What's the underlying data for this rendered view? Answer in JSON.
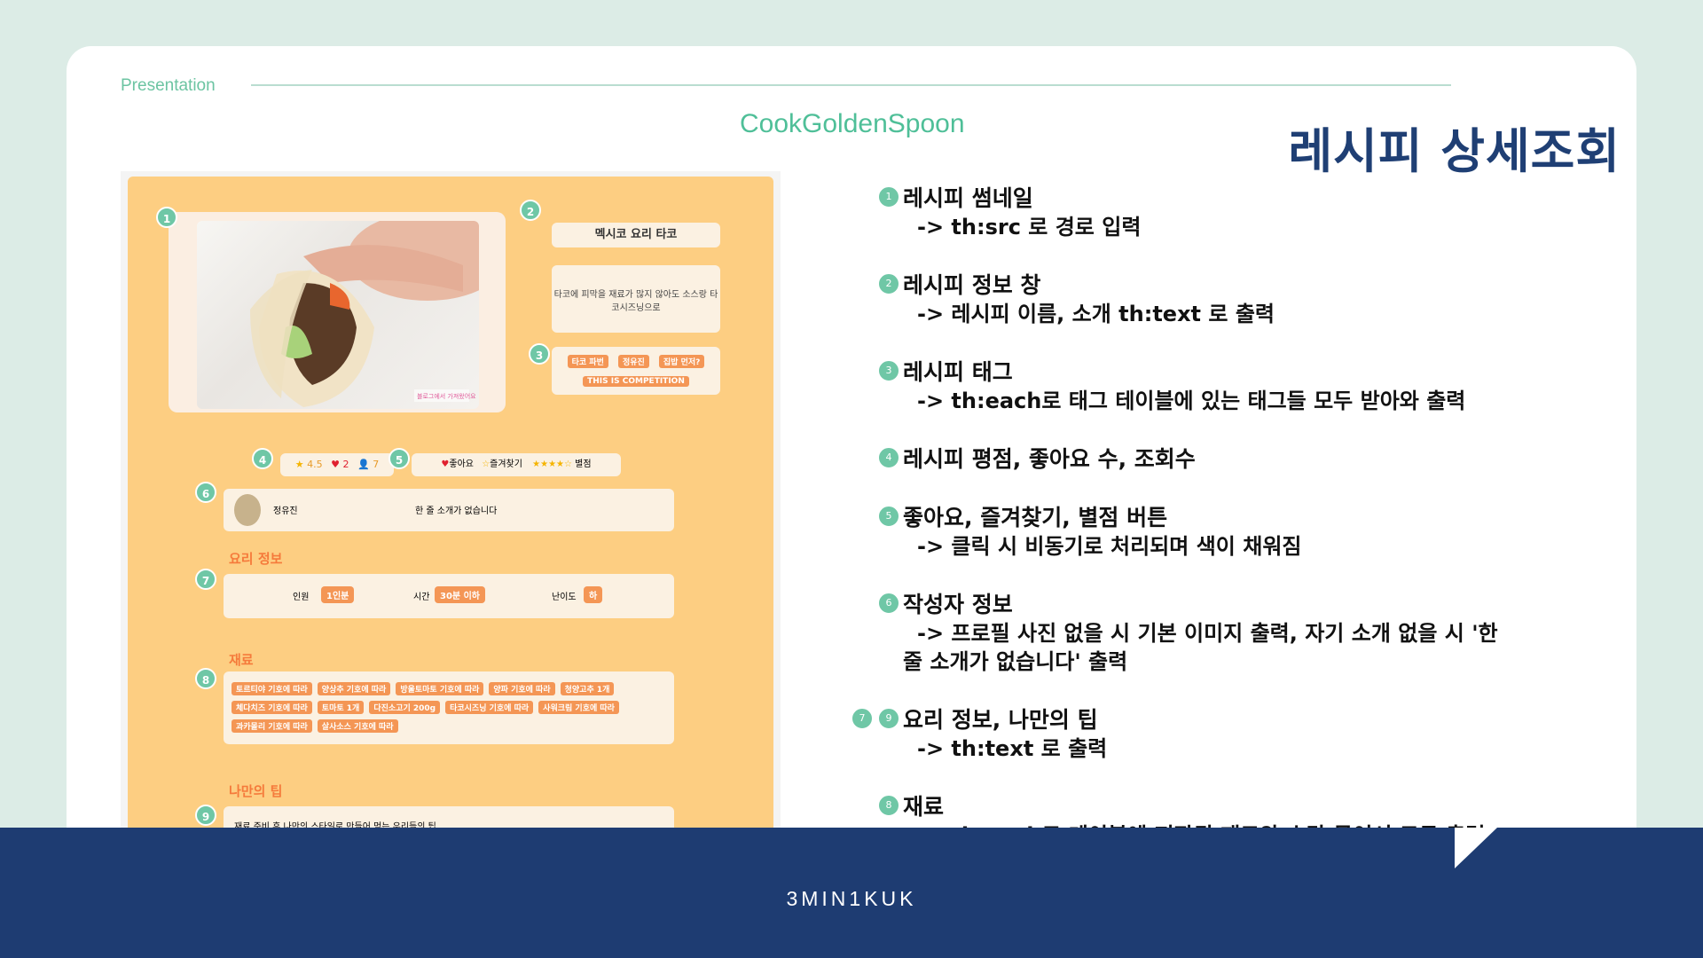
{
  "header": {
    "section_label": "Presentation",
    "brand": "CookGoldenSpoon",
    "title": "레시피 상세조회"
  },
  "footer": {
    "text": "3MIN1KUK"
  },
  "screenshot": {
    "recipe_title": "멕시코 요리 타코",
    "recipe_desc": "타코에 피막을 재료가 많지 않아도 소스랑 타코시즈닝으로",
    "image_watermark": "블로그에서 가져왔어요",
    "tags": [
      "타코 파번",
      "정유진",
      "집밥 먼저?",
      "THIS IS COMPETITION"
    ],
    "stats": {
      "rating": "4.5",
      "likes": "2",
      "views": "7"
    },
    "actions": {
      "like": "좋아요",
      "favorite": "즐겨찾기",
      "score": "별점"
    },
    "author": {
      "name": "정유진",
      "intro": "한 줄 소개가 없습니다"
    },
    "cook_info_heading": "요리 정보",
    "cook_info": {
      "people_label": "인원",
      "people_value": "1인분",
      "time_label": "시간",
      "time_value": "30분 이하",
      "level_label": "난이도",
      "level_value": "하"
    },
    "ingredients_heading": "재료",
    "ingredients": [
      "토르티야 기호에 따라",
      "양상추 기호에 따라",
      "방울토마토 기호에 따라",
      "양파 기호에 따라",
      "청양고추 1개",
      "체다치즈 기호에 따라",
      "토마토 1개",
      "다진소고기 200g",
      "타코시즈닝 기호에 따라",
      "사워크림 기호에 따라",
      "과카몰리 기호에 따라",
      "살사소스 기호에 따라"
    ],
    "tip_heading": "나만의 팁",
    "tip": "재료 준비 후 나만의 스타일로 만들어 먹는 우리들의 팁"
  },
  "notes": [
    {
      "num": "1",
      "title": "레시피 썸네일",
      "detail": "-> th:src 로 경로 입력"
    },
    {
      "num": "2",
      "title": "레시피 정보 창",
      "detail": "-> 레시피 이름, 소개 th:text 로 출력"
    },
    {
      "num": "3",
      "title": "레시피 태그",
      "detail": "-> th:each로 태그 테이블에 있는 태그들 모두 받아와 출력"
    },
    {
      "num": "4",
      "title": "레시피 평점, 좋아요 수, 조회수",
      "detail": ""
    },
    {
      "num": "5",
      "title": "좋아요, 즐겨찾기, 별점 버튼",
      "detail": "-> 클릭 시 비동기로 처리되며 색이 채워짐"
    },
    {
      "num": "6",
      "title": "작성자 정보",
      "detail": "-> 프로필 사진 없을 시 기본 이미지 출력, 자기 소개 없을 시 '한",
      "detail_cont": "줄 소개가 없습니다' 출력"
    },
    {
      "num": "9",
      "num_extra": "7",
      "title": "요리 정보, 나만의 팁",
      "detail": "-> th:text 로 출력"
    },
    {
      "num": "8",
      "title": "재료",
      "detail": "-> th:each로 테이블에 저장된 재료와 수량 묶어서 모두 출력"
    }
  ],
  "colors": {
    "accent": "#6fc7a6",
    "navy": "#1e3c72",
    "panel": "#fdce82",
    "tag": "#f49655"
  }
}
